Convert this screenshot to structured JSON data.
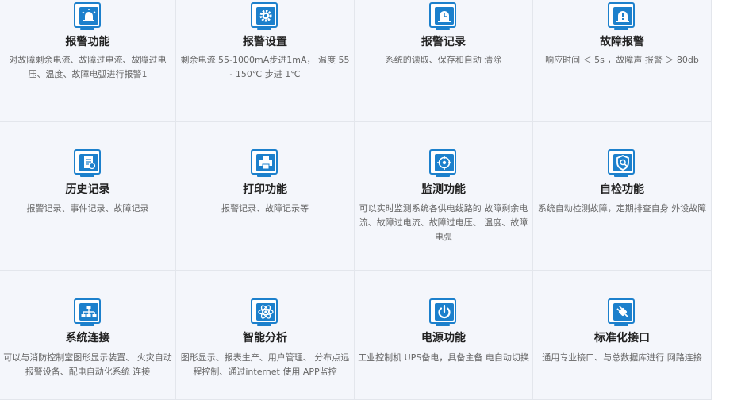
{
  "brand_color": "#1c80cc",
  "features": [
    {
      "icon": "alarm-light-icon",
      "title": "报警功能",
      "desc": "对故障剩余电流、故障过电流、故障过电压、温度、故障电弧进行报警1"
    },
    {
      "icon": "gear-icon",
      "title": "报警设置",
      "desc": "剩余电流 55-1000mA步进1mA， 温度 55 - 150℃ 步进 1℃"
    },
    {
      "icon": "alarm-clock-icon",
      "title": "报警记录",
      "desc": "系统的读取、保存和自动 清除"
    },
    {
      "icon": "warning-light-icon",
      "title": "故障报警",
      "desc": "响应时间 ＜ 5s ，故障声 报警 ＞ 80db"
    },
    {
      "icon": "history-record-icon",
      "title": "历史记录",
      "desc": "报警记录、事件记录、故障记录"
    },
    {
      "icon": "printer-icon",
      "title": "打印功能",
      "desc": "报警记录、故障记录等"
    },
    {
      "icon": "target-icon",
      "title": "监测功能",
      "desc": "可以实时监测系统各供电线路的 故障剩余电流、故障过电流、故障过电压、 温度、故障电弧"
    },
    {
      "icon": "shield-search-icon",
      "title": "自检功能",
      "desc": "系统自动检测故障，定期排查自身 外设故障"
    },
    {
      "icon": "network-icon",
      "title": "系统连接",
      "desc": "可以与消防控制室图形显示装置、 火灾自动报警设备、配电自动化系统 连接"
    },
    {
      "icon": "atom-icon",
      "title": "智能分析",
      "desc": "图形显示、报表生产、用户管理、 分布点远程控制、通过internet 使用 APP监控"
    },
    {
      "icon": "power-icon",
      "title": "电源功能",
      "desc": "工业控制机 UPS备电，具备主备 电自动切换"
    },
    {
      "icon": "plug-icon",
      "title": "标准化接口",
      "desc": "通用专业接口、与总数据库进行 网路连接"
    }
  ]
}
